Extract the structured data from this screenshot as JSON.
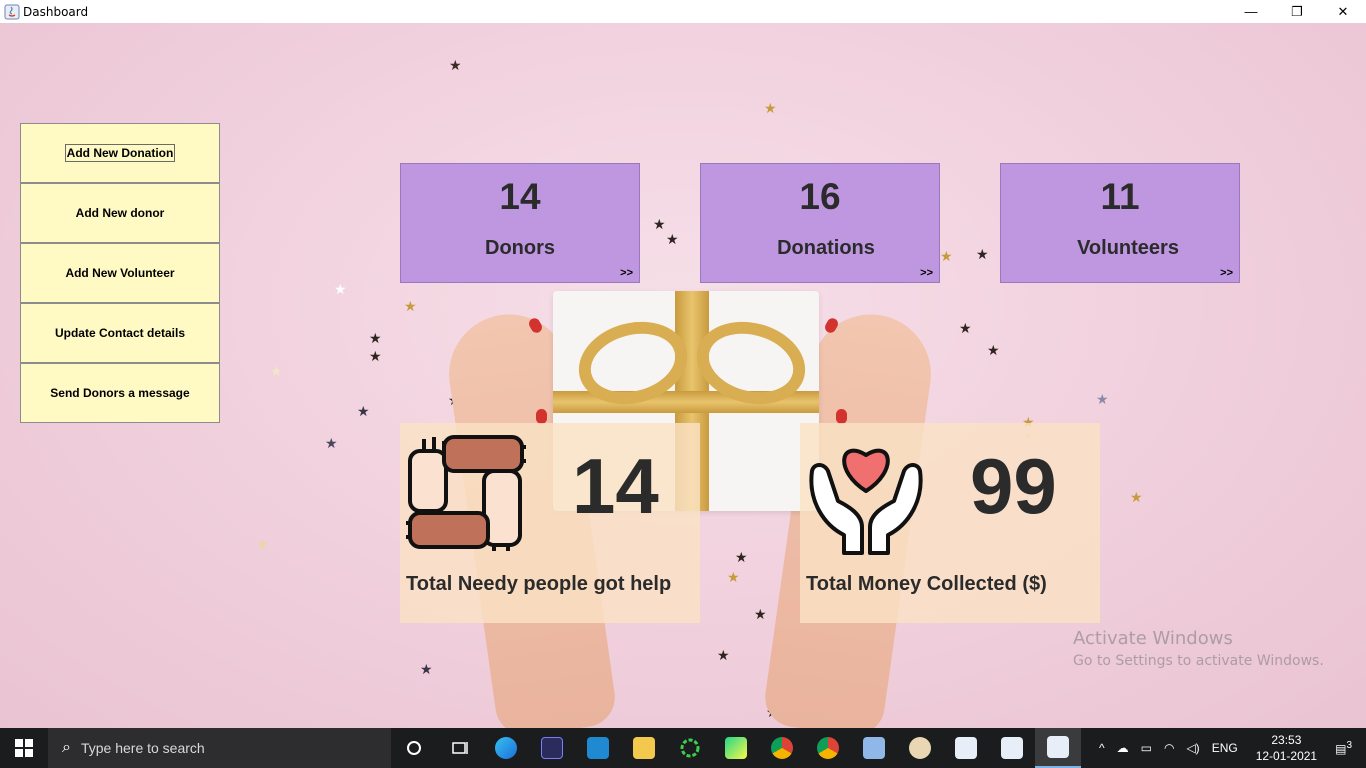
{
  "window": {
    "title": "Dashboard",
    "controls": [
      "—",
      "❐",
      "✕"
    ]
  },
  "menu": [
    {
      "label": "Add New Donation"
    },
    {
      "label": "Add New donor"
    },
    {
      "label": "Add New Volunteer"
    },
    {
      "label": "Update Contact details"
    },
    {
      "label": "Send Donors a message"
    }
  ],
  "cards": [
    {
      "value": "14",
      "label": "Donors",
      "more": ">>"
    },
    {
      "value": "16",
      "label": "Donations",
      "more": ">>"
    },
    {
      "value": "11",
      "label": "Volunteers",
      "more": ">>"
    }
  ],
  "panels": [
    {
      "value": "14",
      "caption": "Total Needy people got help",
      "icon": "helping-hands-icon"
    },
    {
      "value": "99",
      "caption": "Total Money Collected ($)",
      "icon": "heart-hands-icon"
    }
  ],
  "watermark": {
    "line1": "Activate Windows",
    "line2": "Go to Settings to activate Windows."
  },
  "taskbar": {
    "search_placeholder": "Type here to search",
    "language": "ENG",
    "time": "23:53",
    "date": "12-01-2021",
    "notification_count": "3"
  },
  "colors": {
    "card_bg": "#bf97e0",
    "menu_bg": "#fff9c4",
    "panel_bg": "#fae2c4",
    "accent": "#7db4e8"
  }
}
